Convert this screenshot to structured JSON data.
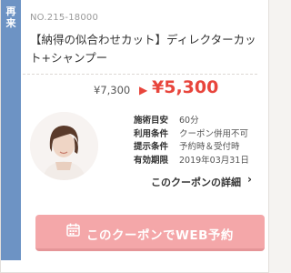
{
  "coupon": {
    "side_tab": "再\n来",
    "number": "NO.215-18000",
    "title": "【納得の似合わせカット】ディレクターカット+シャンプー",
    "regular_price": "¥7,300",
    "arrow": "▶",
    "coupon_price": "¥5,300",
    "details": [
      {
        "label": "施術目安",
        "value": "60分"
      },
      {
        "label": "利用条件",
        "value": "クーポン併用不可"
      },
      {
        "label": "提示条件",
        "value": "予約時＆受付時"
      },
      {
        "label": "有効期限",
        "value": "2019年03月31日"
      }
    ],
    "detail_link": "このクーポンの詳細",
    "reserve_button": "このクーポンでWEB予約",
    "colors": {
      "tab": "#6d93c4",
      "price": "#e8453c",
      "button": "#f4a7a9"
    }
  }
}
